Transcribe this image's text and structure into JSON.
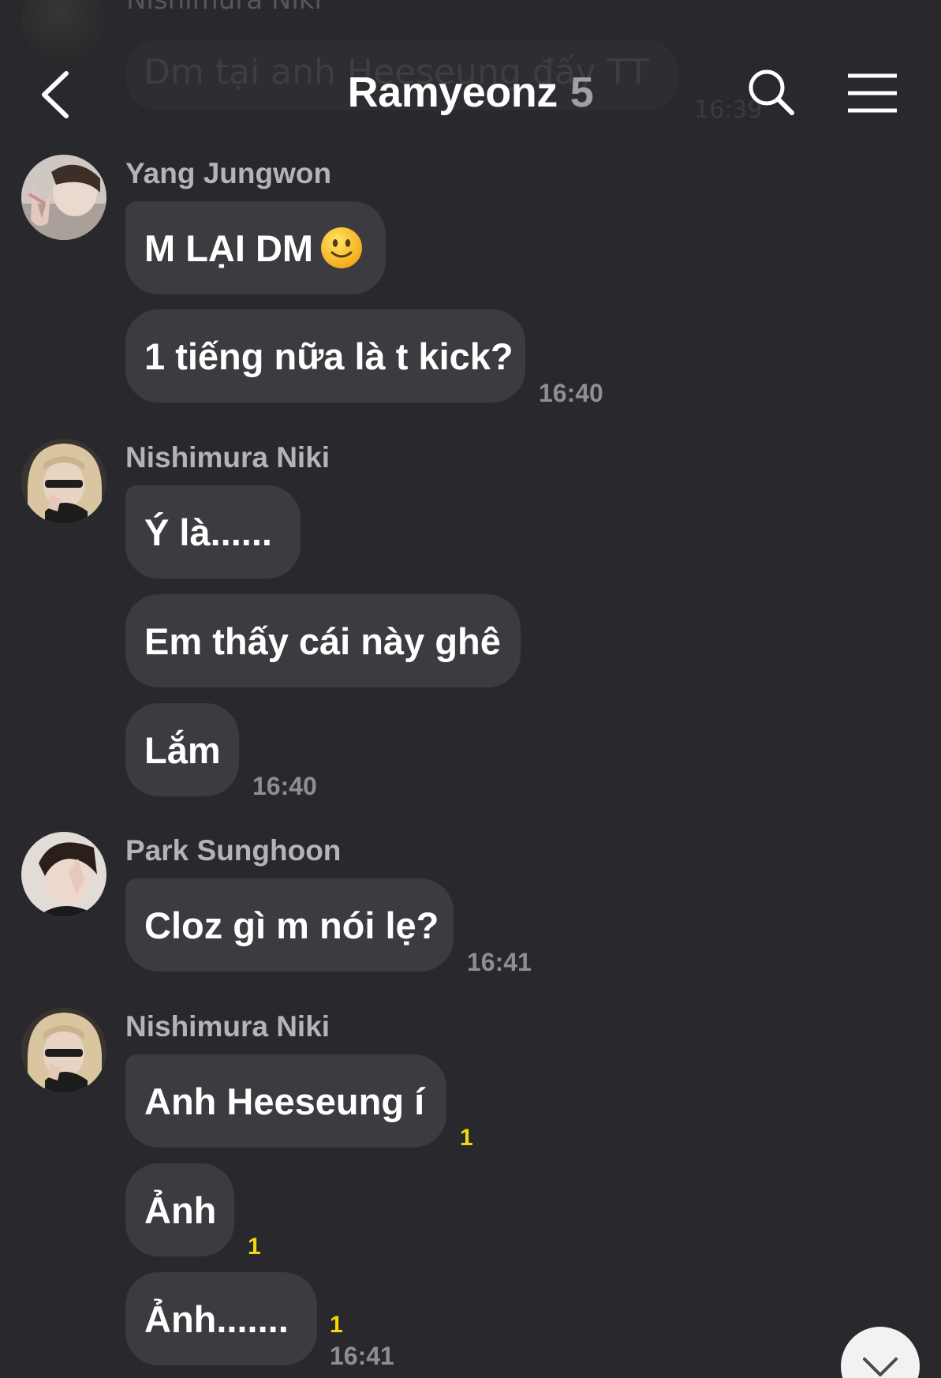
{
  "ghost": {
    "sender": "Nishimura Niki",
    "text": "Dm tại anh Heeseung đấy TT",
    "time": "16:39"
  },
  "header": {
    "title": "Ramyeonz",
    "member_count": "5"
  },
  "messages": [
    {
      "sender": "Yang Jungwon",
      "bubbles": [
        {
          "text": "M LẠI DM"
        },
        {
          "text": "1 tiếng nữa là t kick?"
        }
      ],
      "time": "16:40"
    },
    {
      "sender": "Nishimura Niki",
      "bubbles": [
        {
          "text": "Ý là......"
        },
        {
          "text": "Em thấy cái này ghê"
        },
        {
          "text": "Lắm"
        }
      ],
      "time": "16:40"
    },
    {
      "sender": "Park Sunghoon",
      "bubbles": [
        {
          "text": "Cloz gì m nói lẹ?"
        }
      ],
      "time": "16:41"
    },
    {
      "sender": "Nishimura Niki",
      "bubbles": [
        {
          "text": "Anh Heeseung í",
          "unread": "1"
        },
        {
          "text": "Ảnh",
          "unread": "1"
        },
        {
          "text": "Ảnh.......",
          "unread": "1"
        }
      ],
      "time": "16:41"
    }
  ],
  "icons": {
    "back": "chevron-left-icon",
    "search": "search-icon",
    "menu": "hamburger-menu-icon",
    "scroll": "chevron-down-icon",
    "emoji": "slightly-smiling-face-emoji"
  },
  "colors": {
    "background": "#28282d",
    "bubble": "#3b3b40",
    "sender_name": "#b4b4b8",
    "timestamp": "#8e8e93",
    "unread_badge": "#f5d60f"
  }
}
